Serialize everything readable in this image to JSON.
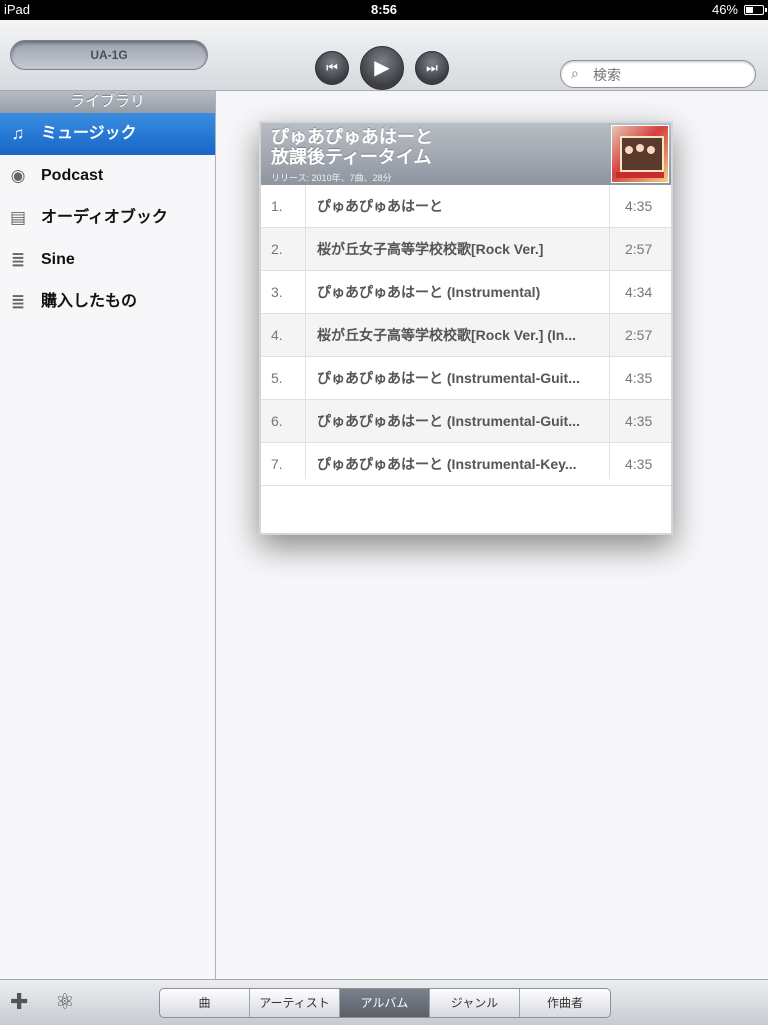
{
  "status_bar": {
    "device": "iPad",
    "time": "8:56",
    "battery": "46%",
    "battery_level": 0.46
  },
  "toolbar": {
    "device_name": "UA-1G",
    "search_placeholder": "検索"
  },
  "sidebar": {
    "header": "ライブラリ",
    "items": [
      {
        "label": "ミュージック",
        "icon": "music-note-icon",
        "selected": true
      },
      {
        "label": "Podcast",
        "icon": "podcast-icon",
        "selected": false
      },
      {
        "label": "オーディオブック",
        "icon": "audiobook-icon",
        "selected": false
      },
      {
        "label": "Sine",
        "icon": "playlist-icon",
        "selected": false
      },
      {
        "label": "購入したもの",
        "icon": "playlist-icon",
        "selected": false
      }
    ]
  },
  "album": {
    "title_line1": "ぴゅあぴゅあはーと",
    "title_line2": "放課後ティータイム",
    "subtitle": "リリース: 2010年、7曲、28分",
    "tracks": [
      {
        "num": "1.",
        "title": "ぴゅあぴゅあはーと",
        "time": "4:35"
      },
      {
        "num": "2.",
        "title": "桜が丘女子高等学校校歌[Rock Ver.]",
        "time": "2:57"
      },
      {
        "num": "3.",
        "title": "ぴゅあぴゅあはーと (Instrumental)",
        "time": "4:34"
      },
      {
        "num": "4.",
        "title": "桜が丘女子高等学校校歌[Rock Ver.] (In...",
        "time": "2:57"
      },
      {
        "num": "5.",
        "title": "ぴゅあぴゅあはーと (Instrumental-Guit...",
        "time": "4:35"
      },
      {
        "num": "6.",
        "title": "ぴゅあぴゅあはーと (Instrumental-Guit...",
        "time": "4:35"
      },
      {
        "num": "7.",
        "title": "ぴゅあぴゅあはーと (Instrumental-Key...",
        "time": "4:35"
      }
    ]
  },
  "bottom_bar": {
    "tabs": [
      {
        "label": "曲",
        "selected": false
      },
      {
        "label": "アーティスト",
        "selected": false
      },
      {
        "label": "アルバム",
        "selected": true
      },
      {
        "label": "ジャンル",
        "selected": false
      },
      {
        "label": "作曲者",
        "selected": false
      }
    ]
  }
}
